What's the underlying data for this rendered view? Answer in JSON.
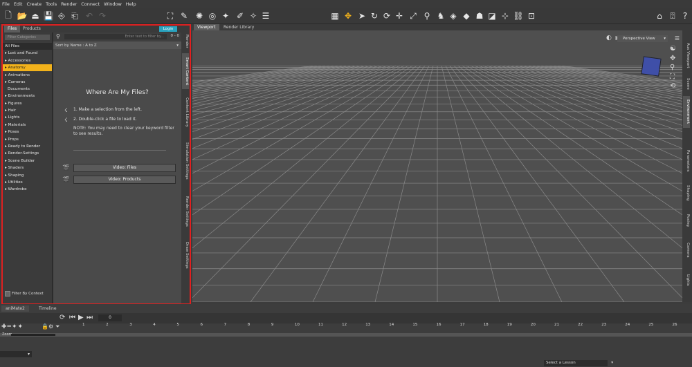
{
  "menu": [
    "File",
    "Edit",
    "Create",
    "Tools",
    "Render",
    "Connect",
    "Window",
    "Help"
  ],
  "library": {
    "tabs": [
      "Files",
      "Products"
    ],
    "login_label": "Login",
    "category_search_placeholder": "Filter Categories",
    "categories": [
      "All Files",
      "Lost and Found",
      "Accessories",
      "Anatomy",
      "Animations",
      "Cameras",
      "Documents",
      "Environments",
      "Figures",
      "Hair",
      "Lights",
      "Materials",
      "Poses",
      "Props",
      "Ready to Render",
      "Render-Settings",
      "Scene Builder",
      "Shaders",
      "Shaping",
      "Utilities",
      "Wardrobe"
    ],
    "selected_category": "Anatomy",
    "filter_by_context": "Filter By Context",
    "search_placeholder": "Enter text to filter by...",
    "result_count": "0 - 0",
    "sort_label": "Sort by Name : A to Z",
    "help_title": "Where Are My Files?",
    "step1": "1. Make a selection from the left.",
    "step2": "2. Double-click a file to load it.",
    "note": "NOTE: You may need to clear your keyword filter to see results.",
    "video_files": "Video: Files",
    "video_products": "Video: Products",
    "side_tabs": [
      "Render",
      "Smart Content",
      "Content Library",
      "Simulation Settings",
      "Render Settings",
      "Draw Settings"
    ]
  },
  "viewport": {
    "tabs": [
      "Viewport",
      "Render Library"
    ],
    "view_select": "Perspective View"
  },
  "right_tabs": [
    "Aux Viewport",
    "Scene",
    "Environment",
    "Parameters",
    "Shaping",
    "Posing",
    "Camera",
    "Lights"
  ],
  "timeline": {
    "tabs": [
      "aniMate2",
      "Timeline"
    ],
    "frame_value": "0",
    "zoom_label": "Zoom",
    "frame_ticks": [
      "1",
      "2",
      "3",
      "4",
      "5",
      "6",
      "7",
      "8",
      "9",
      "10",
      "11",
      "12",
      "13",
      "14",
      "15",
      "16",
      "17",
      "18",
      "19",
      "20",
      "21",
      "22",
      "23",
      "24",
      "25",
      "26"
    ],
    "lesson_select": "Select a Lesson"
  }
}
